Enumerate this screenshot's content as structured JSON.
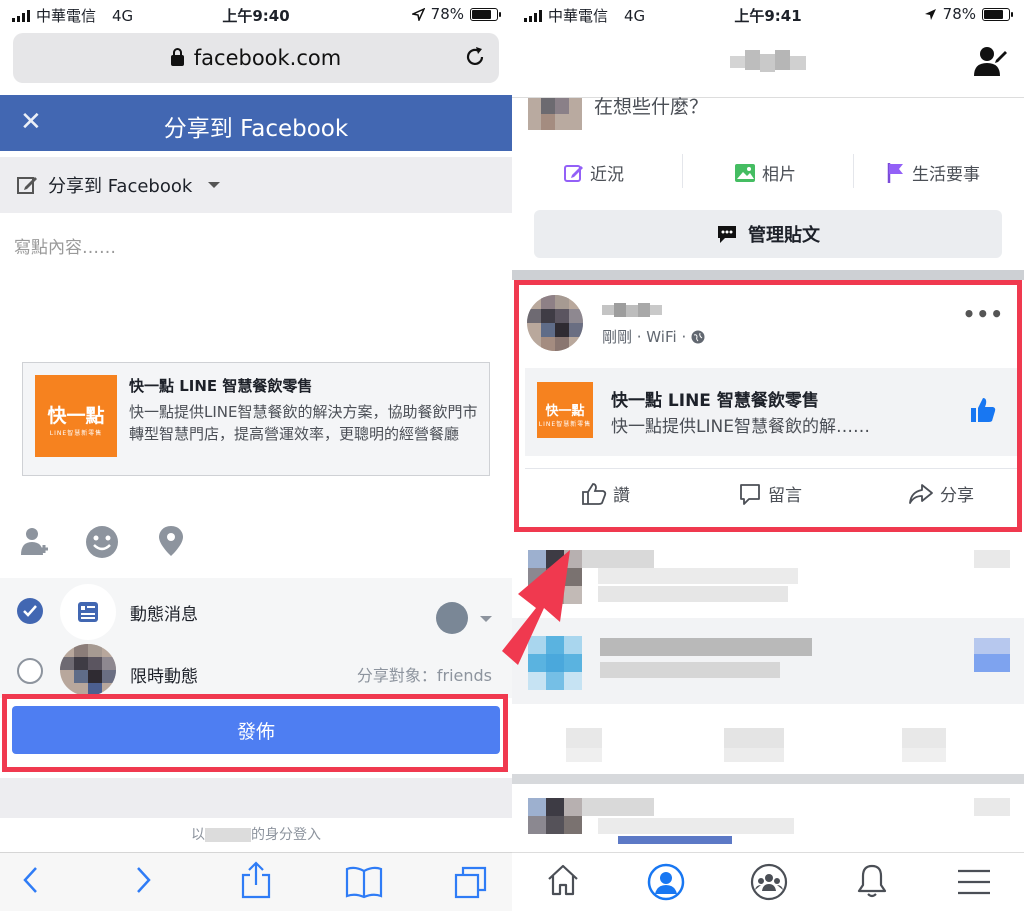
{
  "status_left": {
    "carrier": "中華電信",
    "network": "4G",
    "time": "上午9:40",
    "battery": "78%"
  },
  "status_right": {
    "carrier": "中華電信",
    "network": "4G",
    "time": "上午9:41",
    "battery": "78%"
  },
  "browser": {
    "url": "facebook.com"
  },
  "share_dialog": {
    "title": "分享到 Facebook",
    "share_target": "分享到 Facebook",
    "placeholder": "寫點內容……",
    "link_card": {
      "logo_text": "快一點",
      "logo_subtext": "LINE智慧新零售",
      "title": "快一點 LINE 智慧餐飲零售",
      "description": "快一點提供LINE智慧餐飲的解決方案，協助餐飲門市轉型智慧門店，提高營運效率，更聰明的經營餐廳"
    },
    "audience": {
      "news_feed": "動態消息",
      "story": "限時動態",
      "story_audience": "分享對象：friends"
    },
    "post_button": "發佈",
    "logged_in_prefix": "以",
    "logged_in_suffix": "的身分登入"
  },
  "profile": {
    "whats_on_mind": "在想些什麼？",
    "tabs": {
      "status": "近況",
      "photo": "相片",
      "life_event": "生活要事"
    },
    "manage_posts": "管理貼文",
    "post": {
      "meta": "剛剛 · WiFi ·",
      "more": "•••",
      "card_title": "快一點 LINE 智慧餐飲零售",
      "card_desc": "快一點提供LINE智慧餐飲的解……",
      "actions": {
        "like": "讚",
        "comment": "留言",
        "share": "分享"
      }
    }
  },
  "colors": {
    "facebook_blue": "#4267b2",
    "highlight_red": "#f0394f",
    "post_button": "#4e7ef2",
    "brand_orange": "#f6821f"
  }
}
